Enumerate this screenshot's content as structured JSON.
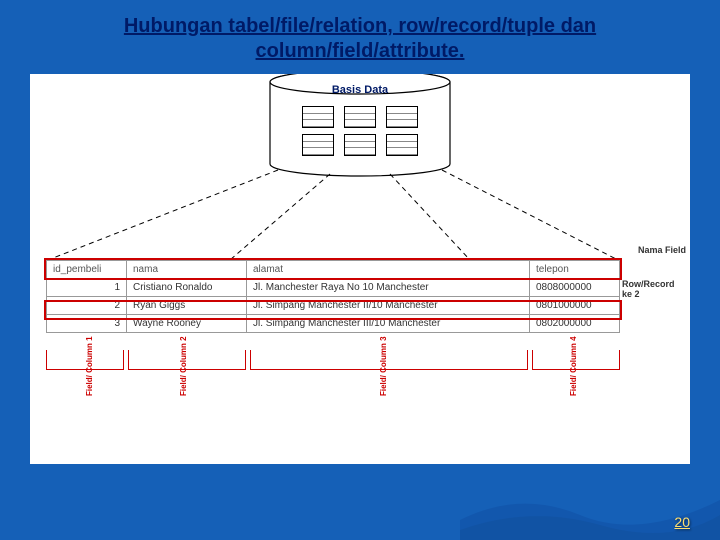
{
  "title": "Hubungan tabel/file/relation, row/record/tuple dan column/field/attribute.",
  "db_label": "Basis Data",
  "headers": {
    "c1": "id_pembeli",
    "c2": "nama",
    "c3": "alamat",
    "c4": "telepon"
  },
  "rows": [
    {
      "c1": "1",
      "c2": "Cristiano Ronaldo",
      "c3": "Jl. Manchester Raya No 10 Manchester",
      "c4": "0808000000"
    },
    {
      "c1": "2",
      "c2": "Ryan Giggs",
      "c3": "Jl. Simpang Manchester II/10 Manchester",
      "c4": "0801000000"
    },
    {
      "c1": "3",
      "c2": "Wayne Rooney",
      "c3": "Jl. Simpang Manchester III/10 Manchester",
      "c4": "0802000000"
    }
  ],
  "labels": {
    "field_name": "Nama Field",
    "row_record": "Row/Record ke 2",
    "col1": "Field/ Column 1",
    "col2": "Field/ Column 2",
    "col3": "Field/ Column 3",
    "col4": "Field/ Column 4"
  },
  "page_number": "20"
}
